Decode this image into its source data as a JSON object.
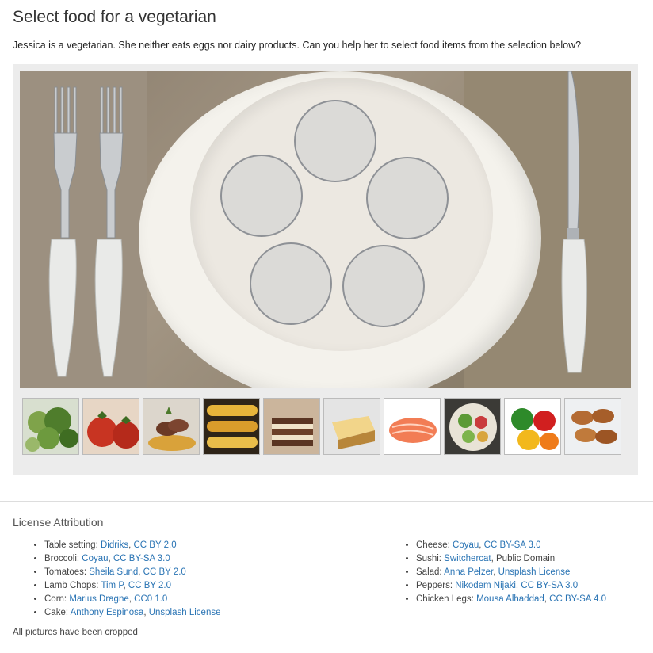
{
  "title": "Select food for a vegetarian",
  "intro": "Jessica is a vegetarian. She neither eats eggs nor dairy products. Can you help her to select food items from the selection below?",
  "thumbnails": [
    "broccoli",
    "tomatoes",
    "lamb-chops",
    "corn",
    "cake",
    "cheese",
    "sushi",
    "salad",
    "peppers",
    "chicken-legs"
  ],
  "license": {
    "heading": "License Attribution",
    "left": [
      {
        "item": "Table setting: ",
        "author": "Didriks",
        "sep": ", ",
        "license": "CC BY 2.0"
      },
      {
        "item": "Broccoli: ",
        "author": "Coyau",
        "sep": ", ",
        "license": "CC BY-SA 3.0"
      },
      {
        "item": "Tomatoes: ",
        "author": "Sheila Sund",
        "sep": ", ",
        "license": "CC BY 2.0"
      },
      {
        "item": "Lamb Chops: ",
        "author": "Tim P",
        "sep": ", ",
        "license": "CC BY 2.0"
      },
      {
        "item": "Corn: ",
        "author": "Marius Dragne",
        "sep": ", ",
        "license": "CC0 1.0"
      },
      {
        "item": "Cake: ",
        "author": "Anthony Espinosa",
        "sep": ", ",
        "license": "Unsplash License"
      }
    ],
    "right": [
      {
        "item": "Cheese: ",
        "author": "Coyau",
        "sep": ", ",
        "license": "CC BY-SA 3.0"
      },
      {
        "item": "Sushi: ",
        "author": "Switchercat",
        "sep": ", ",
        "license": "Public Domain",
        "plain_license": true
      },
      {
        "item": "Salad: ",
        "author": "Anna Pelzer",
        "sep": ", ",
        "license": "Unsplash License"
      },
      {
        "item": "Peppers: ",
        "author": "Nikodem Nijaki",
        "sep": ", ",
        "license": "CC BY-SA 3.0"
      },
      {
        "item": "Chicken Legs: ",
        "author": "Mousa Alhaddad",
        "sep": ", ",
        "license": "CC BY-SA 4.0"
      }
    ]
  },
  "footnote": "All pictures have been cropped"
}
